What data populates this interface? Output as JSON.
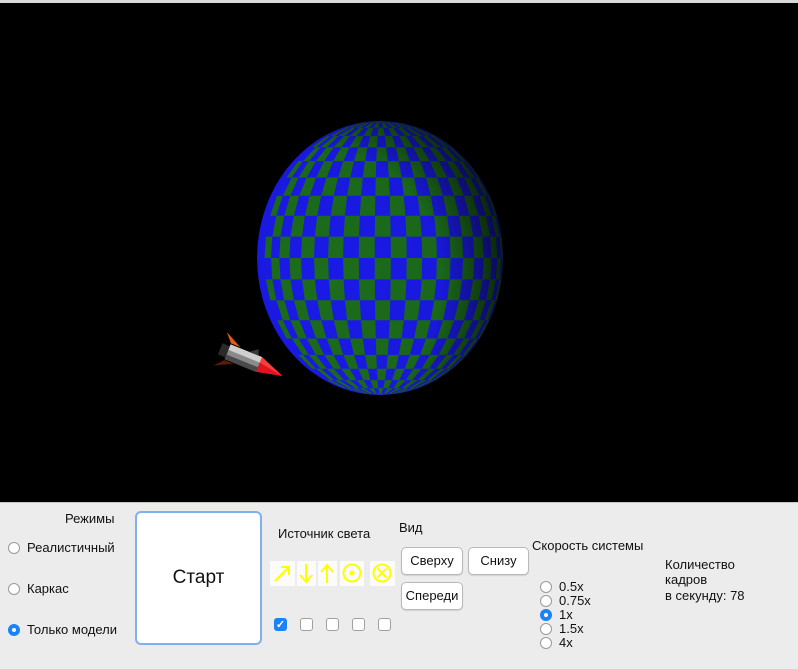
{
  "viewport": {
    "background": "#000000",
    "sphere_colors": [
      "#1a1ae8",
      "#1c6d1c"
    ],
    "objects": [
      "checkered-sphere",
      "rocket"
    ]
  },
  "modes": {
    "title": "Режимы",
    "options": [
      "Реалистичный",
      "Каркас",
      "Только модели"
    ],
    "selected": "Только модели"
  },
  "start_label": "Старт",
  "light": {
    "title": "Источник света",
    "icons": [
      "arrow-up-right-icon",
      "arrow-down-icon",
      "arrow-up-icon",
      "dot-circle-icon",
      "cross-circle-icon"
    ],
    "checked": [
      true,
      false,
      false,
      false,
      false
    ],
    "color": "#ffff00"
  },
  "view": {
    "title": "Вид",
    "top_label": "Сверху",
    "bottom_label": "Снизу",
    "front_label": "Спереди"
  },
  "speed": {
    "title": "Скорость системы",
    "options": [
      "0.5x",
      "0.75x",
      "1x",
      "1.5x",
      "4x"
    ],
    "selected": "1x"
  },
  "fps": {
    "line1": "Количество",
    "line2": "кадров",
    "line3": "в секунду: 78",
    "value": 78
  },
  "accent_color": "#1a82fb"
}
